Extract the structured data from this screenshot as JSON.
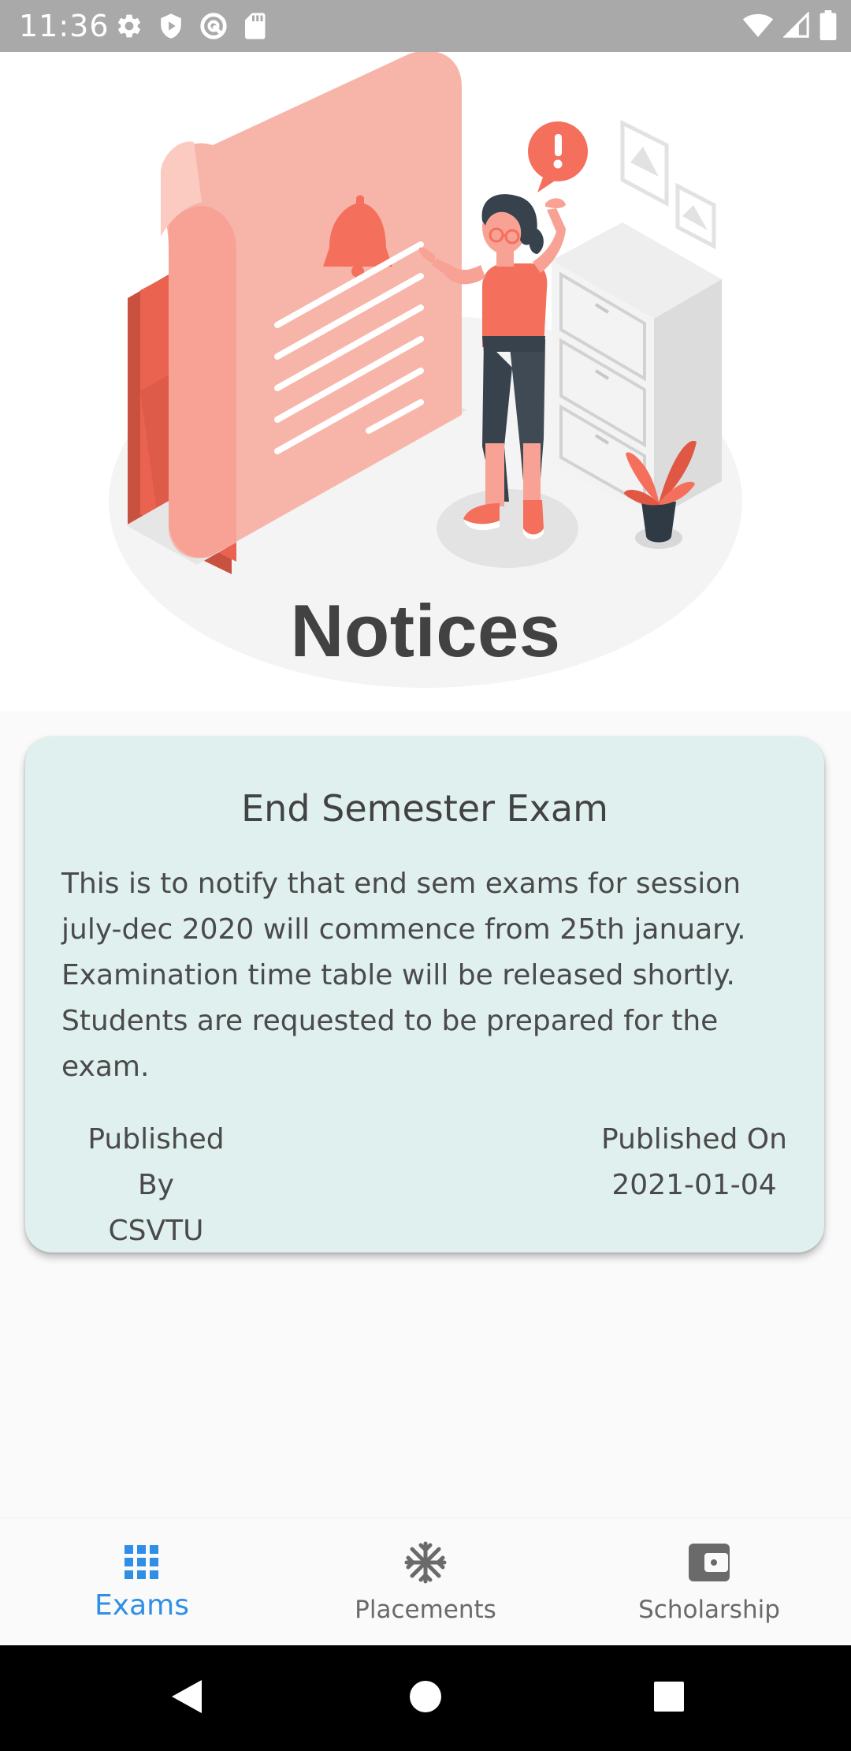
{
  "status_bar": {
    "time": "11:36",
    "left_icons": [
      "gear-icon",
      "shield-icon",
      "sync-icon",
      "sd-card-icon"
    ],
    "right_icons": [
      "wifi-icon",
      "signal-icon",
      "battery-icon"
    ]
  },
  "hero": {
    "title": "Notices",
    "illustration": "notice-illustration"
  },
  "notice": {
    "title": "End Semester Exam",
    "body": "This is to notify that end sem exams for session july-dec 2020 will commence from 25th january. Examination time table will be released shortly. Students are requested to be prepared for the exam.",
    "published_by_label": "Published By",
    "published_by_value": "CSVTU",
    "published_on_label": "Published On",
    "published_on_value": "2021-01-04"
  },
  "bottom_nav": {
    "items": [
      {
        "label": "Exams",
        "icon": "grid-icon",
        "active": true
      },
      {
        "label": "Placements",
        "icon": "snowflake-icon",
        "active": false
      },
      {
        "label": "Scholarship",
        "icon": "wallet-icon",
        "active": false
      }
    ]
  },
  "system_nav": {
    "buttons": [
      "back-icon",
      "home-icon",
      "recents-icon"
    ]
  },
  "colors": {
    "accent": "#2f8fe6",
    "illustration_primary": "#f4705c",
    "card_background": "#e0f0ef",
    "status_bar": "#a9a9a9"
  }
}
